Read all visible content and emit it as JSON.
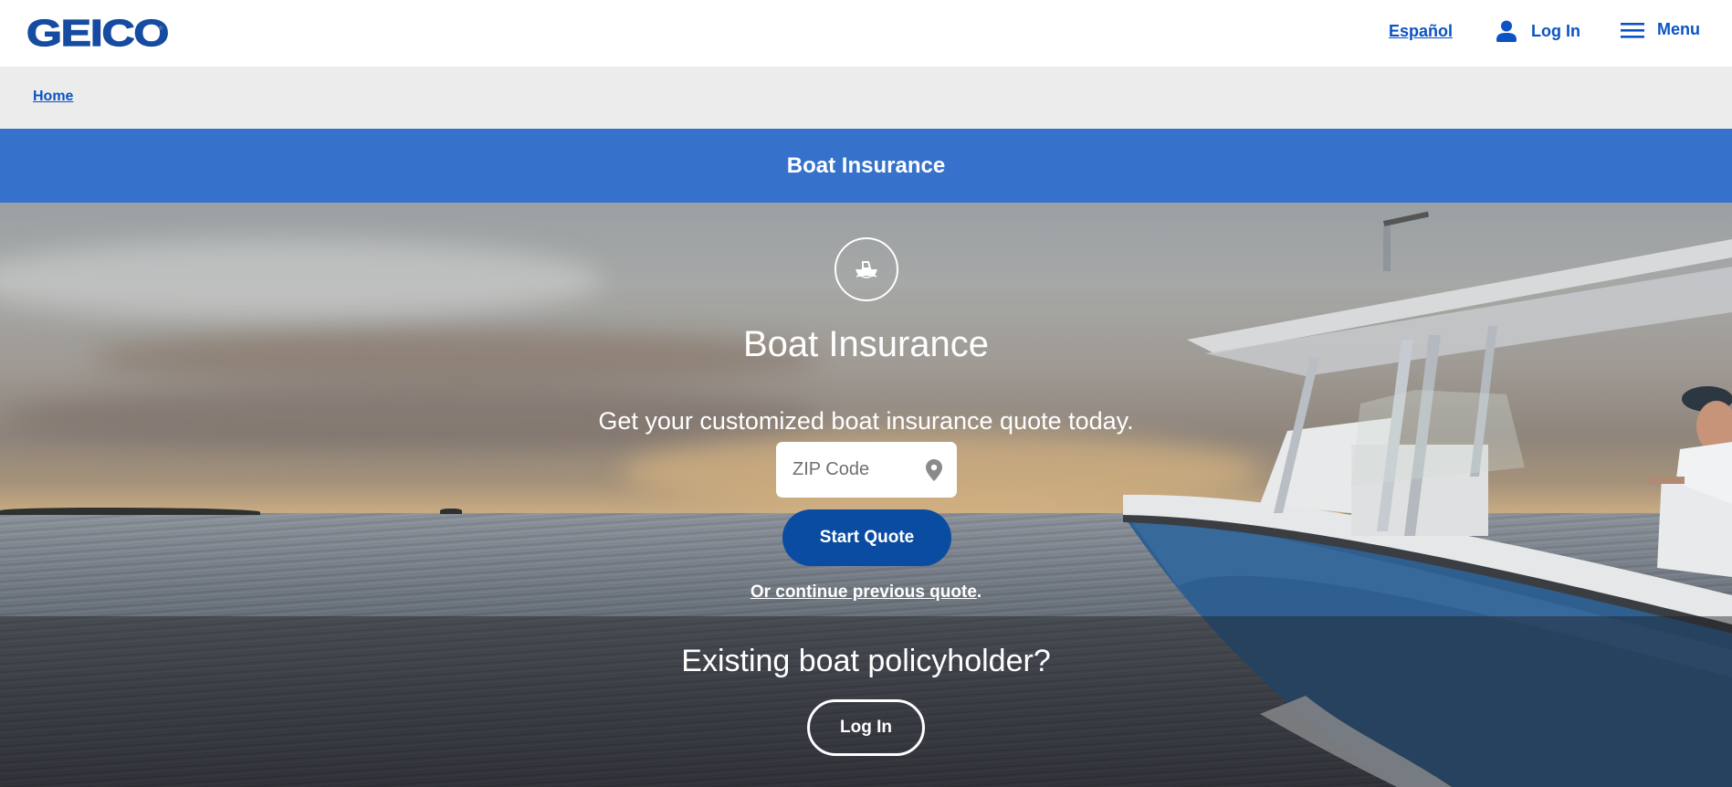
{
  "header": {
    "logo_text": "GEICO",
    "logo_reg": "®",
    "nav": {
      "espanol": "Español",
      "login": "Log In",
      "menu": "Menu"
    }
  },
  "breadcrumb": {
    "home": "Home"
  },
  "band": {
    "title": "Boat Insurance"
  },
  "hero": {
    "icon": "boat-icon",
    "title": "Boat Insurance",
    "subtitle": "Get your customized boat insurance quote today.",
    "zip_placeholder": "ZIP Code",
    "zip_value": "",
    "start_quote": "Start Quote",
    "continue_link": "Or continue previous quote",
    "continue_suffix": ".",
    "existing_title": "Existing boat policyholder?",
    "existing_login": "Log In"
  },
  "colors": {
    "brand_blue": "#154ba0",
    "link_blue": "#0b53c4",
    "band_blue": "#3672cc",
    "button_blue": "#0a4ca1",
    "breadcrumb_bg": "#ececec"
  }
}
